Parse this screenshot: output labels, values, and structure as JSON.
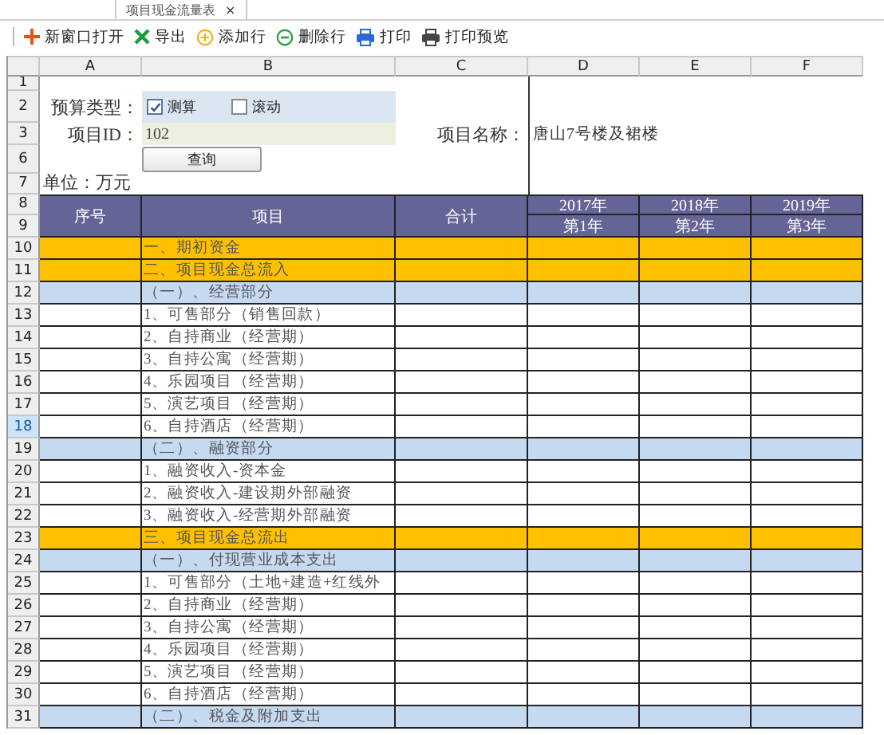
{
  "tab": {
    "title": "项目现金流量表",
    "close": "×"
  },
  "toolbar": [
    {
      "label": "新窗口打开",
      "kind": "plus"
    },
    {
      "label": "导出",
      "kind": "cross"
    },
    {
      "label": "添加行",
      "kind": "add"
    },
    {
      "label": "删除行",
      "kind": "remove"
    },
    {
      "label": "打印",
      "kind": "print"
    },
    {
      "label": "打印预览",
      "kind": "preview"
    }
  ],
  "columns": [
    "A",
    "B",
    "C",
    "D",
    "E",
    "F"
  ],
  "form": {
    "row_headers": [
      {
        "label": "1",
        "selected": false
      },
      {
        "label": "2",
        "selected": false
      },
      {
        "label": "3",
        "selected": false
      },
      {
        "label": "6",
        "selected": false
      },
      {
        "label": "7",
        "selected": false
      }
    ],
    "budget_type_label": "预算类型：",
    "budget_types": [
      {
        "label": "测算",
        "checked": true
      },
      {
        "label": "滚动",
        "checked": false
      }
    ],
    "project_id_label": "项目ID：",
    "project_id": "102",
    "query_button": "查询",
    "project_name_label": "项目名称：",
    "project_name": "唐山7号楼及裙楼",
    "unit": "单位：万元"
  },
  "table": {
    "header_rows": [
      {
        "label": "8",
        "selected": false
      },
      {
        "label": "9",
        "selected": false
      }
    ],
    "columns": [
      "序号",
      "项目",
      "合计"
    ],
    "years": [
      {
        "year": "2017年",
        "index": "第1年"
      },
      {
        "year": "2018年",
        "index": "第2年"
      },
      {
        "year": "2019年",
        "index": "第3年"
      }
    ],
    "rows": [
      {
        "row": "10",
        "item": "一、期初资金",
        "kind": "major",
        "selected": false
      },
      {
        "row": "11",
        "item": "二、项目现金总流入",
        "kind": "major",
        "selected": false
      },
      {
        "row": "12",
        "item": "（一）、经营部分",
        "kind": "section",
        "selected": false
      },
      {
        "row": "13",
        "item": "1、可售部分（销售回款）",
        "kind": "item",
        "selected": false
      },
      {
        "row": "14",
        "item": "2、自持商业（经营期）",
        "kind": "item",
        "selected": false
      },
      {
        "row": "15",
        "item": "3、自持公寓（经营期）",
        "kind": "item",
        "selected": false
      },
      {
        "row": "16",
        "item": "4、乐园项目（经营期）",
        "kind": "item",
        "selected": false
      },
      {
        "row": "17",
        "item": "5、演艺项目（经营期）",
        "kind": "item",
        "selected": false
      },
      {
        "row": "18",
        "item": "6、自持酒店（经营期）",
        "kind": "item",
        "selected": true
      },
      {
        "row": "19",
        "item": "（二）、融资部分",
        "kind": "section",
        "selected": false
      },
      {
        "row": "20",
        "item": "1、融资收入-资本金",
        "kind": "item",
        "selected": false
      },
      {
        "row": "21",
        "item": "2、融资收入-建设期外部融资",
        "kind": "item",
        "selected": false
      },
      {
        "row": "22",
        "item": "3、融资收入-经营期外部融资",
        "kind": "item",
        "selected": false
      },
      {
        "row": "23",
        "item": "三、项目现金总流出",
        "kind": "major",
        "selected": false
      },
      {
        "row": "24",
        "item": "（一）、付现营业成本支出",
        "kind": "section",
        "selected": false
      },
      {
        "row": "25",
        "item": "1、可售部分（土地+建造+红线外",
        "kind": "item",
        "selected": false
      },
      {
        "row": "26",
        "item": "2、自持商业（经营期）",
        "kind": "item",
        "selected": false
      },
      {
        "row": "27",
        "item": "3、自持公寓（经营期）",
        "kind": "item",
        "selected": false
      },
      {
        "row": "28",
        "item": "4、乐园项目（经营期）",
        "kind": "item",
        "selected": false
      },
      {
        "row": "29",
        "item": "5、演艺项目（经营期）",
        "kind": "item",
        "selected": false
      },
      {
        "row": "30",
        "item": "6、自持酒店（经营期）",
        "kind": "item",
        "selected": false
      },
      {
        "row": "31",
        "item": "（二）、税金及附加支出",
        "kind": "section",
        "selected": false
      }
    ]
  }
}
